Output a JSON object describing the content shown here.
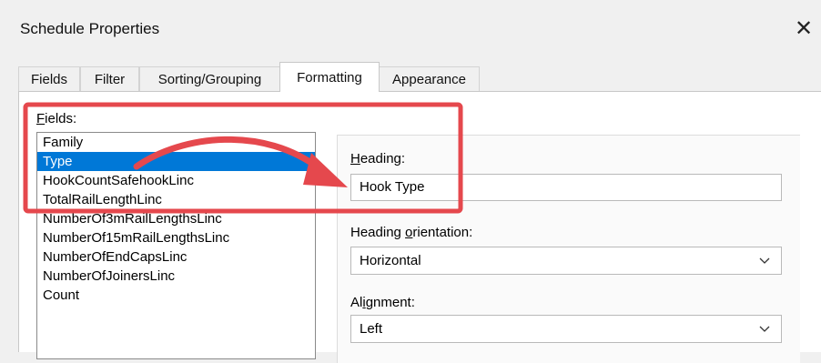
{
  "window": {
    "title": "Schedule Properties",
    "close_glyph": "✕"
  },
  "tabs": [
    {
      "label": "Fields"
    },
    {
      "label": "Filter"
    },
    {
      "label": "Sorting/Grouping"
    },
    {
      "label": "Formatting",
      "active": true
    },
    {
      "label": "Appearance"
    }
  ],
  "fields": {
    "label_mnemonic": "F",
    "label_rest": "ields:",
    "items": [
      "Family",
      "Type",
      "HookCountSafehookLinc",
      "TotalRailLengthLinc",
      "NumberOf3mRailLengthsLinc",
      "NumberOf15mRailLengthsLinc",
      "NumberOfEndCapsLinc",
      "NumberOfJoinersLinc",
      "Count"
    ],
    "selected": "Type"
  },
  "heading": {
    "label_mnemonic": "H",
    "label_rest": "eading:",
    "value": "Hook Type"
  },
  "orientation": {
    "label_pre": "Heading ",
    "label_mnemonic": "o",
    "label_post": "rientation:",
    "value": "Horizontal"
  },
  "alignment": {
    "label_pre": "Al",
    "label_mnemonic": "i",
    "label_post": "gnment:",
    "value": "Left"
  },
  "colors": {
    "selection": "#0078d7",
    "annotation": "#e5484d"
  },
  "icons": {
    "close": "close-icon",
    "dropdown": "chevron-down-icon",
    "annotation_arrow": "curved-arrow-annotation"
  }
}
